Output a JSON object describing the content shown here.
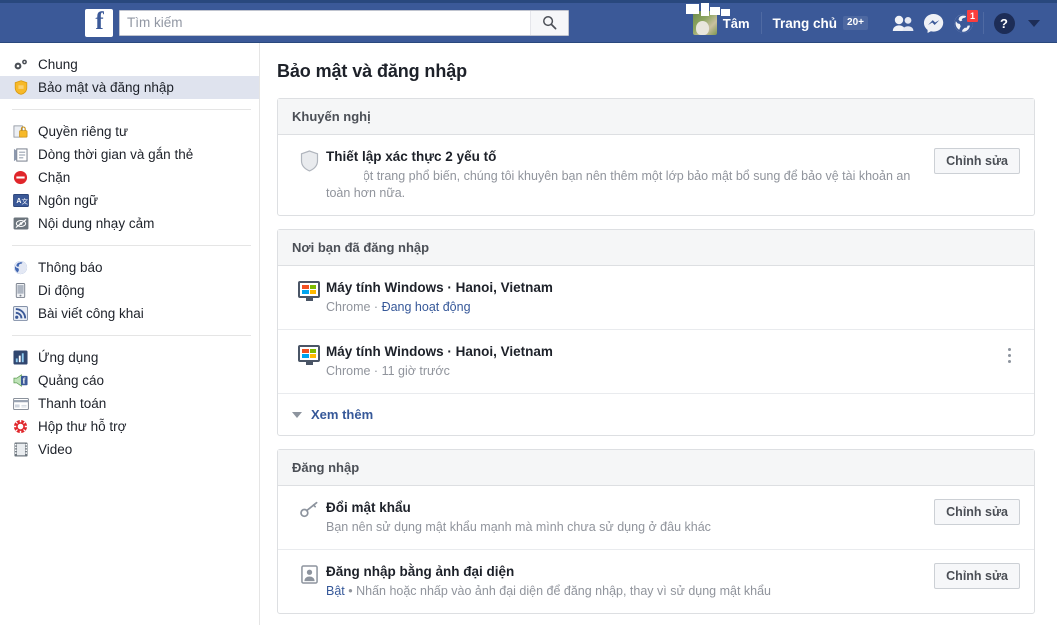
{
  "topbar": {
    "logo": "f",
    "search_placeholder": "Tìm kiếm",
    "search_value": "",
    "search_icon": "search-icon",
    "profile_name": "Tâm",
    "home_label": "Trang chủ",
    "home_badge": "20+",
    "friends_icon": "friend-requests-icon",
    "messenger_icon": "messenger-icon",
    "notifications_icon": "globe-notifications-icon",
    "notifications_badge": "1",
    "help_label": "?",
    "account_menu_icon": "chevron-down-icon",
    "bar_color": "#3b5998",
    "badge_color": "#fa3e3e"
  },
  "sidebar": {
    "groups": [
      {
        "items": [
          {
            "label": "Chung",
            "icon": "gears-icon",
            "active": false
          },
          {
            "label": "Bảo mật và đăng nhập",
            "icon": "shield-icon",
            "active": true
          }
        ]
      },
      {
        "items": [
          {
            "label": "Quyền riêng tư",
            "icon": "lock-icon",
            "active": false
          },
          {
            "label": "Dòng thời gian và gắn thẻ",
            "icon": "timeline-icon",
            "active": false
          },
          {
            "label": "Chặn",
            "icon": "block-icon",
            "active": false
          },
          {
            "label": "Ngôn ngữ",
            "icon": "language-icon",
            "active": false
          },
          {
            "label": "Nội dung nhạy cảm",
            "icon": "eye-slash-icon",
            "active": false
          }
        ]
      },
      {
        "items": [
          {
            "label": "Thông báo",
            "icon": "globe-icon",
            "active": false
          },
          {
            "label": "Di động",
            "icon": "mobile-icon",
            "active": false
          },
          {
            "label": "Bài viết công khai",
            "icon": "rss-icon",
            "active": false
          }
        ]
      },
      {
        "items": [
          {
            "label": "Ứng dụng",
            "icon": "apps-icon",
            "active": false
          },
          {
            "label": "Quảng cáo",
            "icon": "ads-icon",
            "active": false
          },
          {
            "label": "Thanh toán",
            "icon": "payment-card-icon",
            "active": false
          },
          {
            "label": "Hộp thư hỗ trợ",
            "icon": "lifebuoy-icon",
            "active": false
          },
          {
            "label": "Video",
            "icon": "film-icon",
            "active": false
          }
        ]
      }
    ]
  },
  "main": {
    "page_title": "Bảo mật và đăng nhập",
    "cards": [
      {
        "header": "Khuyến nghị",
        "rows": [
          {
            "icon": "shield-outline-icon",
            "title": "Thiết lập xác thực 2 yếu tố",
            "subtitle": "ài là một trang phổ biến, chúng tôi khuyên bạn nên thêm một lớp bảo mật bổ sung để bảo vệ tài khoản an toàn hơn nữa.",
            "action": "Chỉnh sửa"
          }
        ]
      },
      {
        "header": "Nơi bạn đã đăng nhập",
        "rows": [
          {
            "icon": "windows-monitor-icon",
            "title": "Máy tính Windows · Hanoi, Vietnam",
            "sub_prefix": "Chrome · ",
            "sub_link": "Đang hoạt động",
            "menu": null
          },
          {
            "icon": "windows-monitor-icon",
            "title": "Máy tính Windows · Hanoi, Vietnam",
            "sub_prefix": "Chrome · 11 giờ trước",
            "sub_link": "",
            "menu": "kebab-menu-icon"
          }
        ],
        "see_more": "Xem thêm"
      },
      {
        "header": "Đăng nhập",
        "rows": [
          {
            "icon": "key-icon",
            "title": "Đổi mật khẩu",
            "subtitle": "Bạn nên sử dụng mật khẩu mạnh mà mình chưa sử dụng ở đâu khác",
            "action": "Chỉnh sửa"
          },
          {
            "icon": "profile-picture-icon",
            "title": "Đăng nhập bằng ảnh đại diện",
            "sub_status": "Bật",
            "sub_rest": " • Nhấn hoặc nhấp vào ảnh đại diện để đăng nhập, thay vì sử dụng mật khẩu",
            "action": "Chỉnh sửa"
          }
        ]
      }
    ]
  }
}
